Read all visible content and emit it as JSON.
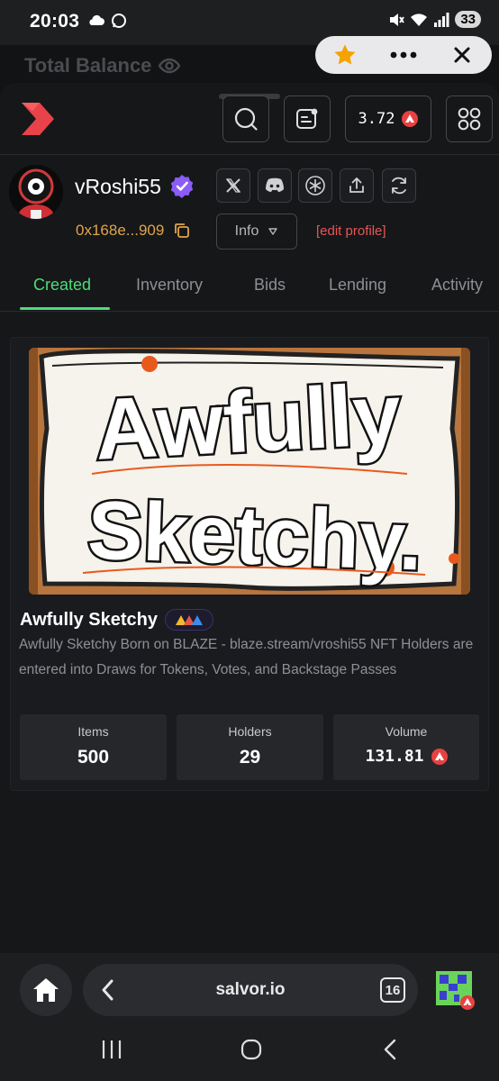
{
  "status_bar": {
    "time": "20:03",
    "battery": "33"
  },
  "background": {
    "title": "Total Balance"
  },
  "topbar": {
    "balance": "3.72"
  },
  "profile": {
    "username": "vRoshi55",
    "address": "0x168e...909",
    "info_label": "Info",
    "edit_label": "[edit profile]"
  },
  "tabs": [
    {
      "label": "Created",
      "active": true
    },
    {
      "label": "Inventory",
      "active": false
    },
    {
      "label": "Bids",
      "active": false
    },
    {
      "label": "Lending",
      "active": false
    },
    {
      "label": "Activity",
      "active": false
    }
  ],
  "collection": {
    "title": "Awfully Sketchy",
    "art_text_1": "Awfully",
    "art_text_2": "Sketchy.",
    "description": "Awfully Sketchy Born on BLAZE - blaze.stream/vroshi55 NFT Holders are entered into Draws for Tokens, Votes, and Backstage Passes",
    "stats": [
      {
        "label": "Items",
        "value": "500"
      },
      {
        "label": "Holders",
        "value": "29"
      },
      {
        "label": "Volume",
        "value": "131.81"
      }
    ]
  },
  "browser": {
    "url": "salvor.io",
    "tab_count": "16"
  },
  "colors": {
    "accent": "#4ddc7a",
    "avax": "#e84142",
    "address": "#e0a44a",
    "edit": "#e85656"
  },
  "icons": [
    "cloud-icon",
    "whatsapp-icon",
    "mute-icon",
    "wifi-icon",
    "signal-icon",
    "star-icon",
    "more-icon",
    "close-icon",
    "search-icon",
    "notes-icon",
    "grid-icon",
    "verified-icon",
    "x-icon",
    "discord-icon",
    "snowflake-icon",
    "share-icon",
    "refresh-icon",
    "copy-icon",
    "chevron-down-icon",
    "home-icon",
    "back-icon"
  ]
}
